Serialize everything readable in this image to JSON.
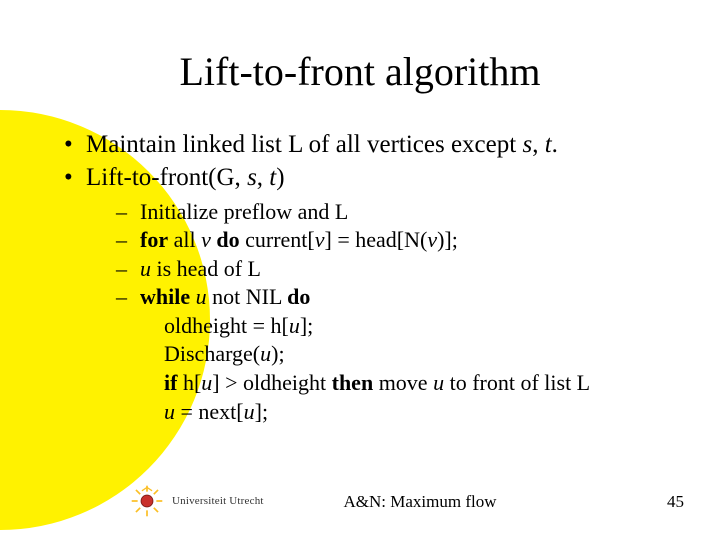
{
  "title": "Lift-to-front algorithm",
  "bullets": {
    "b1_pre": "Maintain linked list L of all vertices except ",
    "b1_s": "s",
    "b1_comma": ", ",
    "b1_t": "t",
    "b1_dot": ".",
    "b2_pre": "Lift-to-front(G, ",
    "b2_s": "s",
    "b2_mid": ", ",
    "b2_t": "t",
    "b2_end": ")"
  },
  "sub": {
    "s1": "Initialize preflow and L",
    "s2_for": "for",
    "s2_all": " all ",
    "s2_v": "v",
    "s2_do": " do",
    "s2_rest1": " current[",
    "s2_v2": "v",
    "s2_rest2": "] = head[N(",
    "s2_v3": "v",
    "s2_rest3": ")];",
    "s3_u": "u",
    "s3_rest": " is head of L",
    "s4_while": "while",
    "s4_sp": " ",
    "s4_u": "u",
    "s4_mid": " not NIL ",
    "s4_do": "do",
    "body1_a": "oldheight = h[",
    "body1_u": "u",
    "body1_b": "];",
    "body2_a": "Discharge(",
    "body2_u": "u",
    "body2_b": ");",
    "body3_if": "if",
    "body3_a": " h[",
    "body3_u": "u",
    "body3_b": "] > oldheight ",
    "body3_then": "then",
    "body3_c": " move ",
    "body3_u2": "u",
    "body3_d": " to front of list L",
    "body4_u": "u",
    "body4_a": " = next[",
    "body4_u2": "u",
    "body4_b": "];"
  },
  "footer": {
    "university": "Universiteit Utrecht",
    "title": "A&N: Maximum flow",
    "page": "45"
  }
}
